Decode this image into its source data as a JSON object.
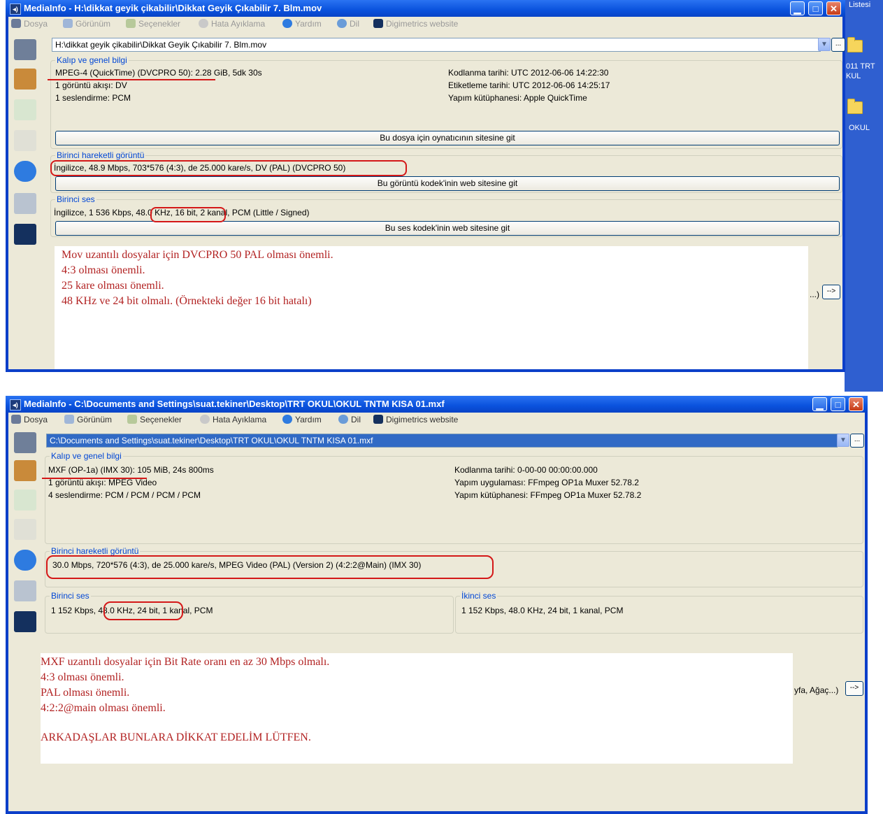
{
  "desktop": {
    "listesi": "Listesi",
    "folder1_line1": "011 TRT",
    "folder1_line2": "KUL",
    "folder2": "OKUL"
  },
  "menu": {
    "dosya": "Dosya",
    "gorunum": "Görünüm",
    "secenekler": "Seçenekler",
    "hata": "Hata Ayıklama",
    "yardim": "Yardım",
    "dil": "Dil",
    "website": "Digimetrics website"
  },
  "window1": {
    "title": "MediaInfo - H:\\dikkat geyik çikabilir\\Dikkat Geyik Çıkabilir 7. Blm.mov",
    "path": "H:\\dikkat geyik çikabilir\\Dikkat Geyik Çıkabilir 7. Blm.mov",
    "general": {
      "legend": "Kalıp ve genel bilgi",
      "left": [
        "MPEG-4 (QuickTime) (DVCPRO 50): 2.28 GiB, 5dk 30s",
        "1 görüntü akışı: DV",
        "1 seslendirme: PCM"
      ],
      "right": [
        "Kodlanma tarihi: UTC 2012-06-06 14:22:30",
        "Etiketleme tarihi: UTC 2012-06-06 14:25:17",
        "Yapım kütüphanesi: Apple QuickTime"
      ],
      "button": "Bu dosya için oynatıcının sitesine git"
    },
    "video": {
      "legend": "Birinci hareketli görüntü",
      "line": "İngilizce, 48.9 Mbps, 703*576 (4:3), de 25.000 kare/s, DV (PAL) (DVCPRO 50)",
      "button": "Bu görüntü kodek'inin web sitesine git"
    },
    "audio": {
      "legend": "Birinci ses",
      "line": "İngilizce, 1 536 Kbps, 48.0 KHz, 16 bit, 2 kanal, PCM (Little / Signed)",
      "button": "Bu ses kodek'inin web sitesine git"
    },
    "notes": [
      "Mov uzantılı dosyalar için DVCPRO 50 PAL olması önemli.",
      "4:3 olması önemli.",
      "25 kare olması önemli.",
      "48 KHz ve 24 bit olmalı. (Örnekteki değer 16 bit hatalı)"
    ],
    "side_label": "...)",
    "arrow": "-->"
  },
  "window2": {
    "title": "MediaInfo - C:\\Documents and Settings\\suat.tekiner\\Desktop\\TRT OKUL\\OKUL TNTM KISA 01.mxf",
    "path": "C:\\Documents and Settings\\suat.tekiner\\Desktop\\TRT OKUL\\OKUL TNTM KISA 01.mxf",
    "general": {
      "legend": "Kalıp ve genel bilgi",
      "left": [
        "MXF (OP-1a) (IMX 30): 105 MiB, 24s 800ms",
        "1 görüntü akışı: MPEG Video",
        "4 seslendirme: PCM / PCM / PCM / PCM"
      ],
      "right": [
        "Kodlanma tarihi: 0-00-00 00:00:00.000",
        "Yapım uygulaması: FFmpeg OP1a Muxer 52.78.2",
        "Yapım kütüphanesi: FFmpeg OP1a Muxer 52.78.2"
      ]
    },
    "video": {
      "legend": "Birinci hareketli görüntü",
      "line": "30.0 Mbps, 720*576 (4:3), de 25.000 kare/s, MPEG Video (PAL) (Version 2) (4:2:2@Main) (IMX 30)"
    },
    "audio1": {
      "legend": "Birinci ses",
      "line": "1 152 Kbps, 48.0 KHz, 24 bit, 1 kanal, PCM"
    },
    "audio2": {
      "legend": "İkinci ses",
      "line": "1 152 Kbps, 48.0 KHz, 24 bit, 1 kanal, PCM"
    },
    "notes": [
      "MXF uzantılı dosyalar için Bit Rate oranı en az 30 Mbps olmalı.",
      "4:3 olması önemli.",
      "PAL olması önemli.",
      "4:2:2@main olması önemli.",
      "ARKADAŞLAR BUNLARA DİKKAT EDELİM LÜTFEN."
    ],
    "side_label": "yfa, Ağaç...)",
    "arrow": "-->"
  },
  "colors": {
    "title_bar": "#0a52dd",
    "legend": "#0046d5",
    "note_text": "#b22222",
    "highlight": "#d41818"
  }
}
